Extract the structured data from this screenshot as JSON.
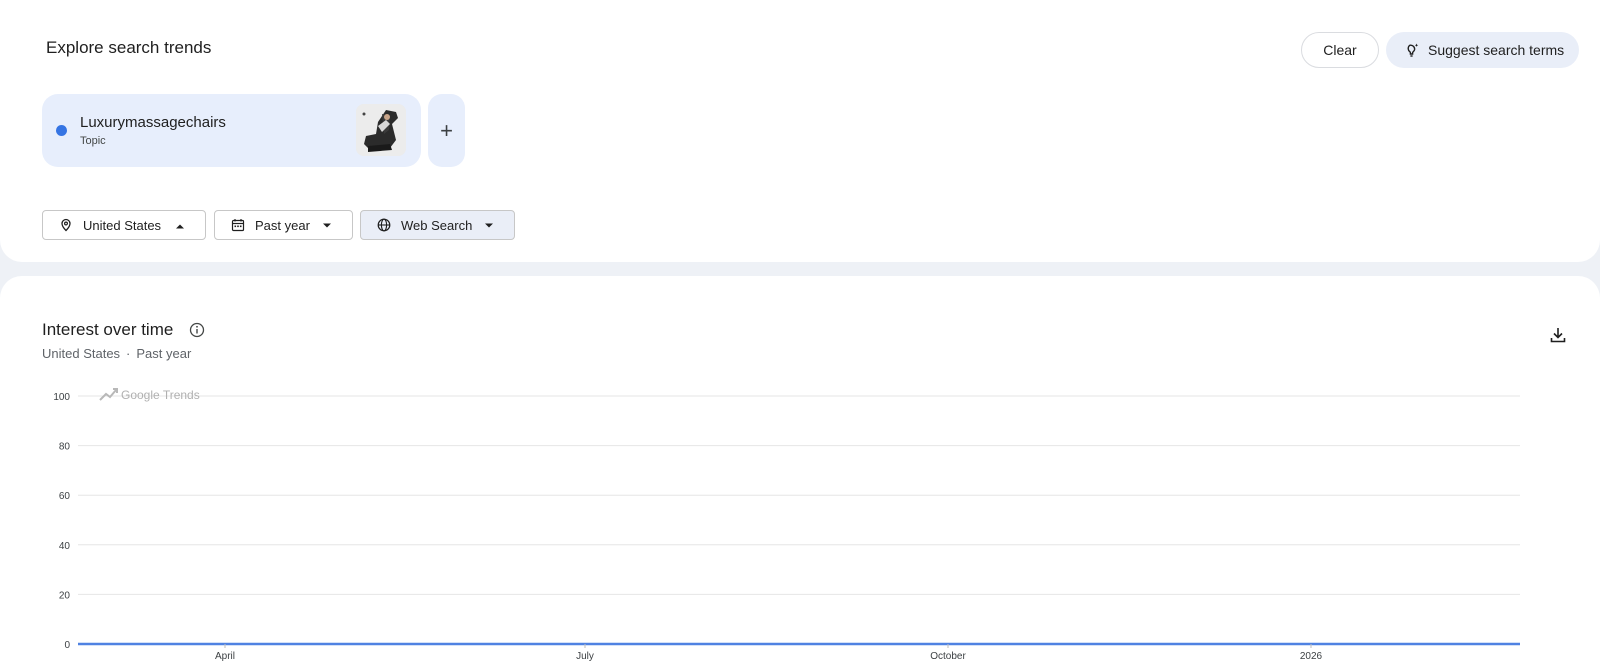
{
  "header": {
    "title": "Explore search trends",
    "clear_label": "Clear",
    "suggest_label": "Suggest search terms"
  },
  "term": {
    "name": "Luxurymassagechairs",
    "type": "Topic",
    "color": "#3574e3",
    "add_label": "+"
  },
  "filters": {
    "location": "United States",
    "time": "Past year",
    "property": "Web Search"
  },
  "chart_section": {
    "title": "Interest over time",
    "subtitle_location": "United States",
    "subtitle_separator": "·",
    "subtitle_time": "Past year",
    "watermark": "Google Trends"
  },
  "chart_data": {
    "type": "line",
    "x_labels": [
      "April",
      "July",
      "October",
      "2026"
    ],
    "y_ticks": [
      0,
      20,
      40,
      60,
      80,
      100
    ],
    "ylim": [
      0,
      100
    ],
    "grid": true,
    "series": [
      {
        "name": "Luxurymassagechairs",
        "color": "#4f82e2",
        "note_x_unit": "weeks",
        "values": [
          0,
          0,
          0,
          0,
          0,
          0,
          0,
          0,
          0,
          0,
          0,
          0,
          0,
          0,
          0,
          0,
          0,
          0,
          0,
          0,
          0,
          0,
          0,
          0,
          0,
          0,
          0,
          0,
          0,
          0,
          0,
          0,
          0,
          0,
          0,
          0,
          0,
          0,
          0,
          0,
          0,
          0,
          0,
          0,
          0,
          0,
          0,
          0,
          0,
          0,
          0,
          0,
          0,
          0,
          0,
          0,
          0,
          0,
          0,
          0,
          0,
          0,
          0,
          0,
          0,
          0,
          0,
          0,
          0,
          0,
          0,
          0,
          0,
          0,
          0,
          0,
          0,
          0,
          0,
          0,
          0,
          0,
          0,
          0,
          0,
          0,
          0,
          0,
          0,
          0,
          0,
          0,
          0,
          0,
          0,
          0,
          0,
          0,
          0,
          0,
          0,
          0,
          0,
          0,
          0,
          0,
          0,
          0,
          0,
          0,
          0,
          0,
          0,
          0,
          0,
          0,
          0,
          0,
          0,
          0,
          0,
          0,
          0,
          0,
          0,
          0,
          0,
          0,
          0,
          0,
          0,
          0,
          0,
          0,
          0,
          0,
          0,
          0,
          0,
          0,
          0,
          0,
          0,
          0,
          0,
          0,
          0,
          0,
          0,
          0,
          0,
          0,
          0,
          0,
          0,
          0,
          0,
          0,
          0,
          0,
          0,
          0,
          0,
          0,
          0,
          0,
          0,
          0,
          0,
          0,
          0,
          0,
          0,
          0,
          0,
          0,
          0,
          0,
          0,
          0,
          0,
          0,
          0,
          0,
          0,
          0,
          0,
          0,
          0,
          0,
          0,
          0,
          0,
          0,
          0,
          0,
          0,
          0,
          0,
          0,
          0,
          0,
          0,
          0,
          0,
          0,
          0,
          0,
          0,
          0,
          0,
          0,
          0,
          0,
          0,
          0,
          0,
          0,
          0,
          0,
          0,
          0,
          0,
          0,
          0,
          0,
          0,
          0,
          0,
          0,
          0,
          0,
          0,
          0,
          0,
          0,
          0,
          0,
          0,
          0,
          0,
          0,
          0,
          0,
          0,
          0,
          0,
          0,
          0,
          0,
          0,
          0,
          0,
          0,
          0,
          0,
          0,
          0,
          0,
          0,
          0,
          0,
          0,
          0,
          0,
          0,
          0,
          0,
          0,
          0,
          0,
          0,
          0,
          0,
          0,
          0,
          0,
          0,
          0,
          0,
          0,
          0,
          0,
          0,
          0,
          0,
          0,
          0,
          0,
          0,
          0,
          0,
          0,
          0,
          0,
          0,
          0,
          0,
          0,
          0,
          0,
          0,
          0,
          0,
          0,
          0,
          0,
          0,
          0,
          0,
          0,
          0,
          0,
          0,
          0,
          0,
          0,
          0,
          0,
          0,
          0,
          0,
          0,
          0,
          0,
          0,
          0,
          0,
          0,
          0,
          0,
          0,
          0,
          0,
          0,
          0,
          0,
          0,
          0,
          0,
          0,
          0,
          0,
          0,
          0,
          0,
          0,
          0,
          0,
          0,
          0,
          0,
          0,
          0,
          0,
          0,
          0,
          0,
          0,
          0,
          0,
          0,
          0,
          0,
          0,
          0,
          0,
          0,
          0,
          0,
          0,
          0,
          0,
          0,
          0,
          0,
          0
        ]
      }
    ]
  }
}
